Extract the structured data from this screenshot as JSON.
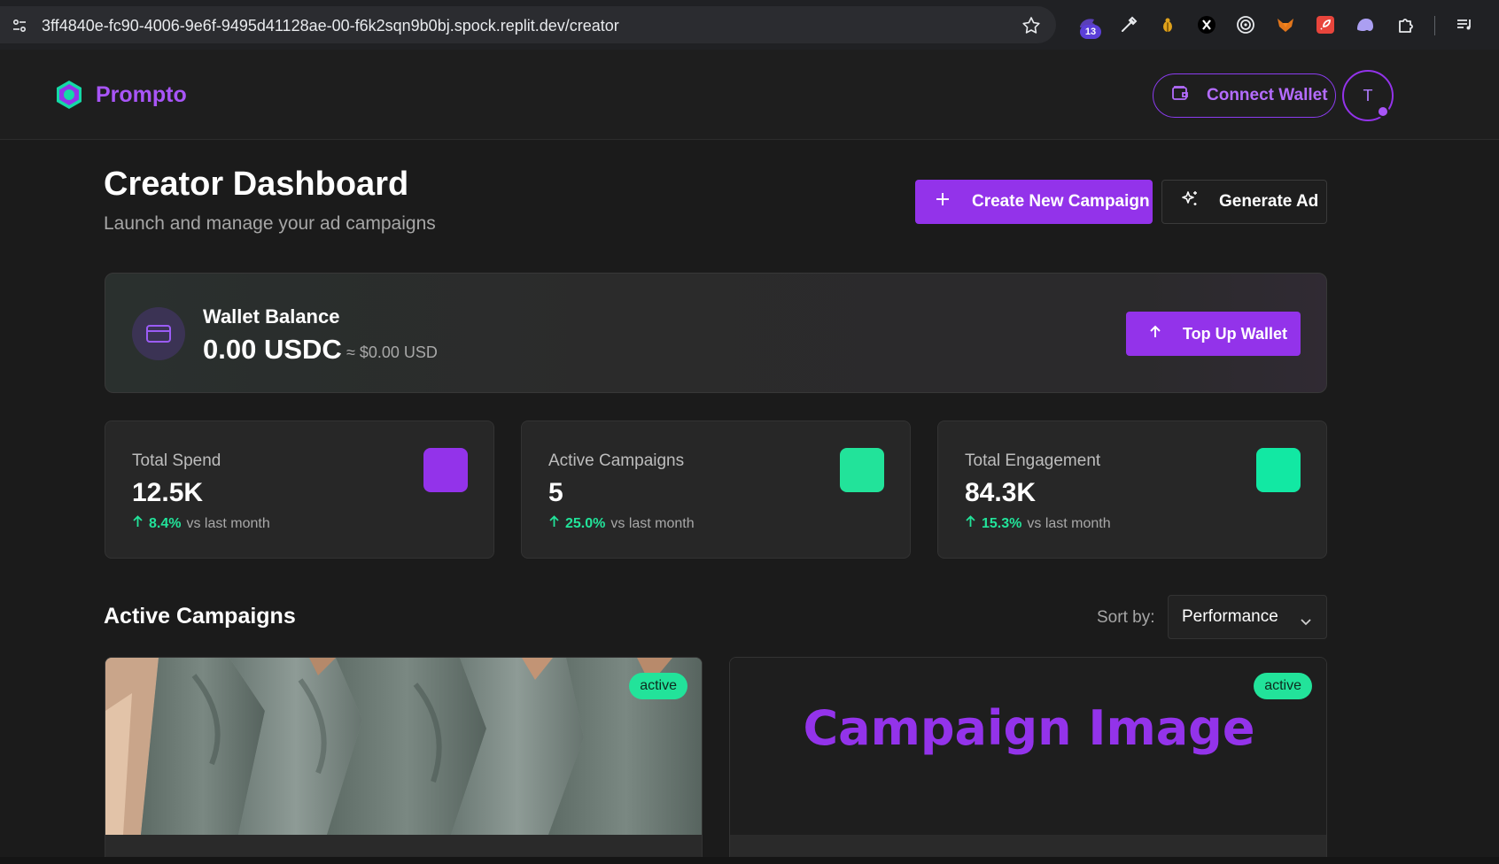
{
  "browser": {
    "url": "3ff4840e-fc90-4006-9e6f-9495d41128ae-00-f6k2sqn9b0bj.spock.replit.dev/creator",
    "extension_badge": "13",
    "extension_icons": [
      "extension-purple-icon",
      "eyedropper-icon",
      "bug-icon",
      "x-logo-icon",
      "target-icon",
      "fox-icon",
      "rocket-icon",
      "ghost-icon",
      "puzzle-icon",
      "media-list-icon"
    ]
  },
  "header": {
    "brand": "Prompto",
    "connect_wallet": "Connect Wallet",
    "avatar_initial": "T"
  },
  "dashboard": {
    "title": "Creator Dashboard",
    "subtitle": "Launch and manage your ad campaigns",
    "create_campaign": "Create New Campaign",
    "generate_ad": "Generate Ad"
  },
  "wallet": {
    "label": "Wallet Balance",
    "amount": "0.00 USDC",
    "usd_equivalent": "≈ $0.00 USD",
    "top_up": "Top Up Wallet"
  },
  "stats": [
    {
      "label": "Total Spend",
      "value": "12.5K",
      "change": "8.4%",
      "change_suffix": "vs last month",
      "swatch": "#9333ea"
    },
    {
      "label": "Active Campaigns",
      "value": "5",
      "change": "25.0%",
      "change_suffix": "vs last month",
      "swatch": "#22e39a"
    },
    {
      "label": "Total Engagement",
      "value": "84.3K",
      "change": "15.3%",
      "change_suffix": "vs last month",
      "swatch": "#12e8a3"
    }
  ],
  "campaigns_section": {
    "title": "Active Campaigns",
    "sort_label": "Sort by:",
    "sort_value": "Performance"
  },
  "campaigns": [
    {
      "status": "active"
    },
    {
      "status": "active",
      "placeholder": "Campaign Image"
    }
  ],
  "colors": {
    "accent": "#9333ea",
    "success": "#22e39a",
    "background": "#1b1b1b"
  }
}
